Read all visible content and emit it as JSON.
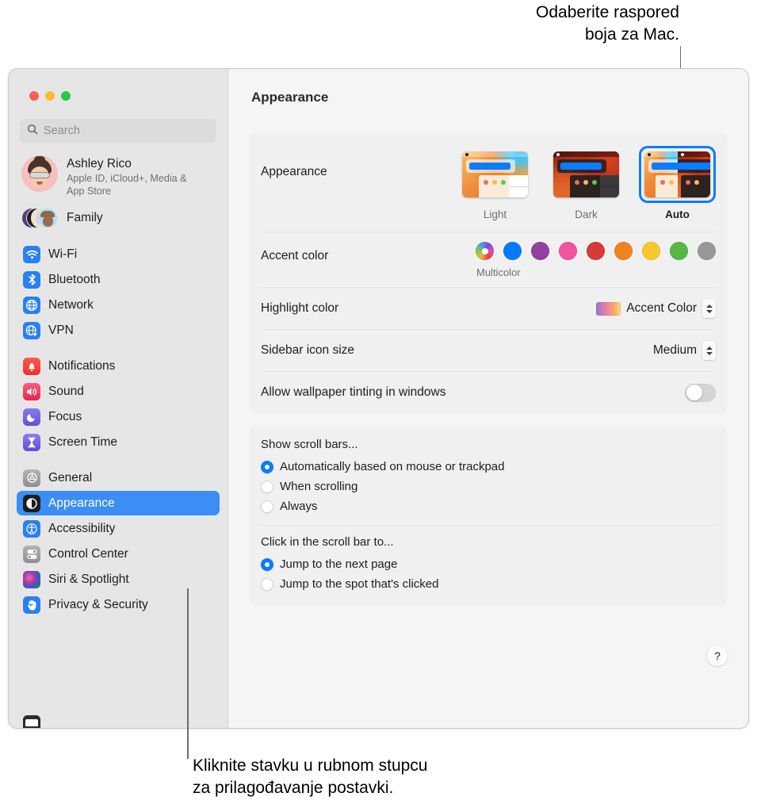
{
  "callouts": {
    "top": "Odaberite raspored\nboja za Mac.",
    "bottom": "Kliknite stavku u rubnom stupcu\nza prilagođavanje postavki."
  },
  "window": {
    "traffic_lights": [
      "close",
      "minimize",
      "zoom"
    ]
  },
  "search": {
    "placeholder": "Search",
    "icon": "search-icon"
  },
  "account": {
    "name": "Ashley Rico",
    "subtitle": "Apple ID, iCloud+, Media & App Store",
    "family_label": "Family"
  },
  "sidebar": {
    "groups": [
      {
        "items": [
          {
            "label": "Wi-Fi",
            "icon": "wifi-icon",
            "selected": false
          },
          {
            "label": "Bluetooth",
            "icon": "bluetooth-icon",
            "selected": false
          },
          {
            "label": "Network",
            "icon": "network-icon",
            "selected": false
          },
          {
            "label": "VPN",
            "icon": "vpn-icon",
            "selected": false
          }
        ]
      },
      {
        "items": [
          {
            "label": "Notifications",
            "icon": "notifications-icon",
            "selected": false
          },
          {
            "label": "Sound",
            "icon": "sound-icon",
            "selected": false
          },
          {
            "label": "Focus",
            "icon": "focus-icon",
            "selected": false
          },
          {
            "label": "Screen Time",
            "icon": "screen-time-icon",
            "selected": false
          }
        ]
      },
      {
        "items": [
          {
            "label": "General",
            "icon": "general-icon",
            "selected": false
          },
          {
            "label": "Appearance",
            "icon": "appearance-icon",
            "selected": true
          },
          {
            "label": "Accessibility",
            "icon": "accessibility-icon",
            "selected": false
          },
          {
            "label": "Control Center",
            "icon": "control-center-icon",
            "selected": false
          },
          {
            "label": "Siri & Spotlight",
            "icon": "siri-icon",
            "selected": false
          },
          {
            "label": "Privacy & Security",
            "icon": "privacy-icon",
            "selected": false
          }
        ]
      }
    ]
  },
  "main": {
    "title": "Appearance",
    "appearance_row": {
      "label": "Appearance",
      "options": [
        {
          "label": "Light",
          "selected": false
        },
        {
          "label": "Dark",
          "selected": false
        },
        {
          "label": "Auto",
          "selected": true
        }
      ]
    },
    "accent_row": {
      "label": "Accent color",
      "selected_label": "Multicolor",
      "swatches": [
        {
          "name": "Multicolor",
          "color": "multicolor"
        },
        {
          "name": "Blue",
          "color": "#007AFF"
        },
        {
          "name": "Purple",
          "color": "#9340A0"
        },
        {
          "name": "Pink",
          "color": "#F0549C"
        },
        {
          "name": "Red",
          "color": "#D73A37"
        },
        {
          "name": "Orange",
          "color": "#EF8321"
        },
        {
          "name": "Yellow",
          "color": "#F7C82E"
        },
        {
          "name": "Green",
          "color": "#55B845"
        },
        {
          "name": "Graphite",
          "color": "#96989A"
        }
      ]
    },
    "highlight_row": {
      "label": "Highlight color",
      "value": "Accent Color"
    },
    "sidebar_icon_row": {
      "label": "Sidebar icon size",
      "value": "Medium"
    },
    "wallpaper_tint_row": {
      "label": "Allow wallpaper tinting in windows",
      "enabled": false
    },
    "scroll_bars": {
      "title": "Show scroll bars...",
      "options": [
        {
          "label": "Automatically based on mouse or trackpad",
          "selected": true
        },
        {
          "label": "When scrolling",
          "selected": false
        },
        {
          "label": "Always",
          "selected": false
        }
      ]
    },
    "scroll_click": {
      "title": "Click in the scroll bar to...",
      "options": [
        {
          "label": "Jump to the next page",
          "selected": true
        },
        {
          "label": "Jump to the spot that's clicked",
          "selected": false
        }
      ]
    },
    "help_label": "?"
  }
}
